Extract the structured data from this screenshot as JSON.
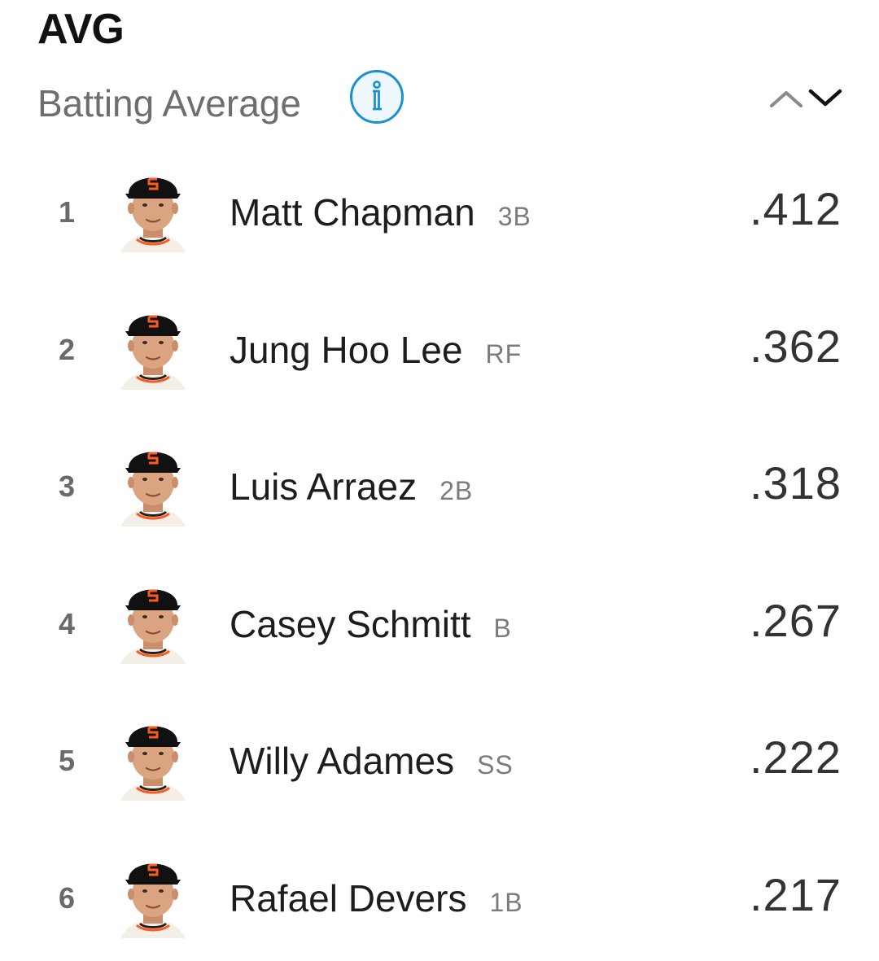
{
  "header": {
    "stat_abbr": "AVG",
    "stat_name": "Batting Average"
  },
  "icons": {
    "info": "info-icon",
    "sort_up": "chevron-up-icon",
    "sort_down": "chevron-down-icon",
    "team_logo": "sf-giants-logo",
    "info_color": "#1a8fd1",
    "cap_color": "#111111",
    "logo_color": "#fd5a1e"
  },
  "leaders": [
    {
      "rank": "1",
      "name": "Matt Chapman",
      "position": "3B",
      "value": ".412"
    },
    {
      "rank": "2",
      "name": "Jung Hoo Lee",
      "position": "RF",
      "value": ".362"
    },
    {
      "rank": "3",
      "name": "Luis Arraez",
      "position": "2B",
      "value": ".318"
    },
    {
      "rank": "4",
      "name": "Casey Schmitt",
      "position": "B",
      "value": ".267"
    },
    {
      "rank": "5",
      "name": "Willy Adames",
      "position": "SS",
      "value": ".222"
    },
    {
      "rank": "6",
      "name": "Rafael Devers",
      "position": "1B",
      "value": ".217"
    }
  ]
}
